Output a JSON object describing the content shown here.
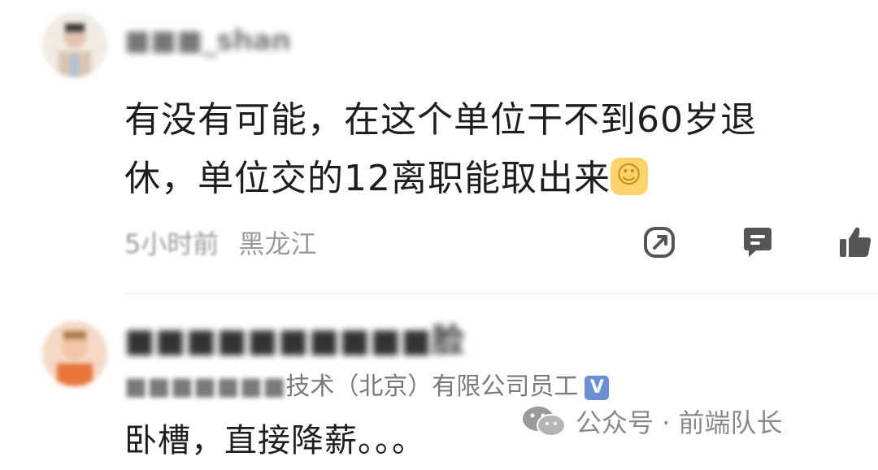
{
  "comments": [
    {
      "username": "■■■_shan",
      "text_line1": "有没有可能，在这个单位干不到60岁退",
      "text_line2": "休，单位交的12离职能取出来",
      "emoji": "☺",
      "time": "5小时前",
      "location": "黑龙江",
      "actions": {
        "share_icon": "share-icon",
        "reply_icon": "reply-icon",
        "like_icon": "thumbs-up-icon"
      }
    },
    {
      "username": "■■■■■■■■■■脸",
      "org_prefix": "■■■■■■■",
      "org_visible": "技术（北京）有限公司员工",
      "verified_badge": "V",
      "text": "卧槽，直接降薪。。。"
    }
  ],
  "watermark": {
    "text": "公众号 · 前端队长",
    "icon": "wechat-icon"
  },
  "colors": {
    "text": "#1e1e1e",
    "meta": "#9a9a9a",
    "verified": "#6b8fd6",
    "icon": "#555555"
  }
}
